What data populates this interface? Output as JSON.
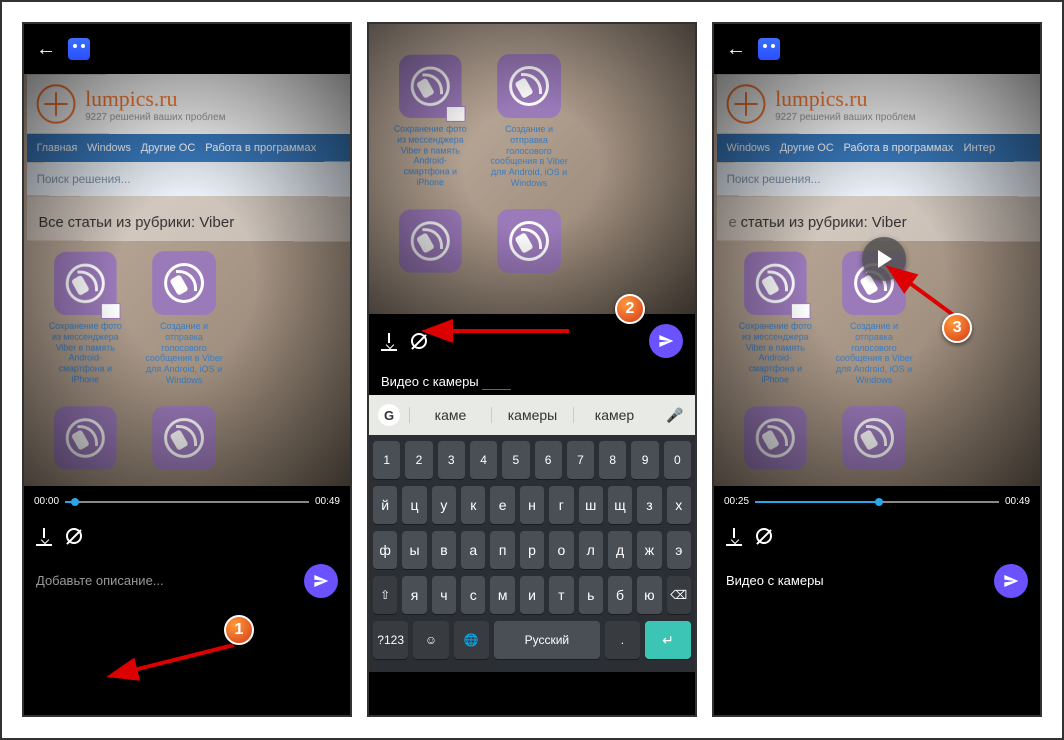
{
  "site": {
    "name": "lumpics.ru",
    "tagline": "9227 решений ваших проблем",
    "nav": [
      "Главная",
      "Windows",
      "Другие ОС",
      "Работа в программах",
      "Интер"
    ],
    "search_placeholder": "Поиск решения...",
    "category_title": "Все статьи из рубрики: Viber",
    "card1": "Сохранение фото из мессенджера Viber в память Android-смартфона и iPhone",
    "card2": "Создание и отправка голосового сообщения в Viber для Android, iOS и Windows"
  },
  "screen1": {
    "time_start": "00:00",
    "time_end": "00:49",
    "caption_placeholder": "Добавьте описание..."
  },
  "screen2": {
    "caption_text": "Видео с камеры",
    "suggestions": {
      "s1": "каме",
      "s2": "камеры",
      "s3": "камер"
    },
    "kb_numbers": [
      "1",
      "2",
      "3",
      "4",
      "5",
      "6",
      "7",
      "8",
      "9",
      "0"
    ],
    "kb_row1": [
      "й",
      "ц",
      "у",
      "к",
      "е",
      "н",
      "г",
      "ш",
      "щ",
      "з",
      "х"
    ],
    "kb_row2": [
      "ф",
      "ы",
      "в",
      "а",
      "п",
      "р",
      "о",
      "л",
      "д",
      "ж",
      "э"
    ],
    "kb_row3": [
      "я",
      "ч",
      "с",
      "м",
      "и",
      "т",
      "ь",
      "б",
      "ю"
    ],
    "kb_lang_switch": "?123",
    "kb_space": "Русский"
  },
  "screen3": {
    "time_current": "00:25",
    "time_end": "00:49",
    "caption_text": "Видео с камеры"
  },
  "callouts": {
    "c1": "1",
    "c2": "2",
    "c3": "3"
  },
  "google_g": "G"
}
